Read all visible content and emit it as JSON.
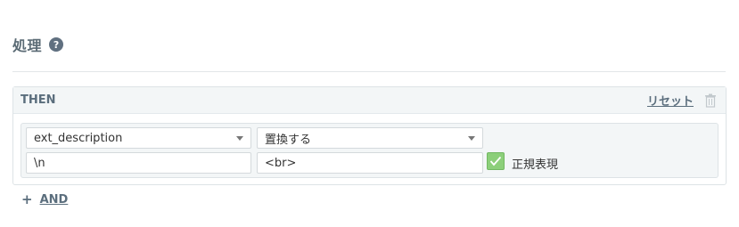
{
  "section": {
    "title": "処理",
    "help_symbol": "?"
  },
  "then_block": {
    "label": "THEN",
    "reset_label": "リセット",
    "trash_icon": "trash-icon"
  },
  "rule": {
    "field_select": {
      "value": "ext_description"
    },
    "action_select": {
      "value": "置換する"
    },
    "search_input": {
      "value": "\\n"
    },
    "replace_input": {
      "value": "<br>"
    },
    "regex_checkbox": {
      "checked": true,
      "label": "正規表現"
    }
  },
  "add_condition": {
    "plus_symbol": "+",
    "label": "AND"
  },
  "colors": {
    "accent": "#5b6e7d",
    "checkbox_green": "#8ccf7a",
    "panel_bg": "#f3f6f7"
  }
}
